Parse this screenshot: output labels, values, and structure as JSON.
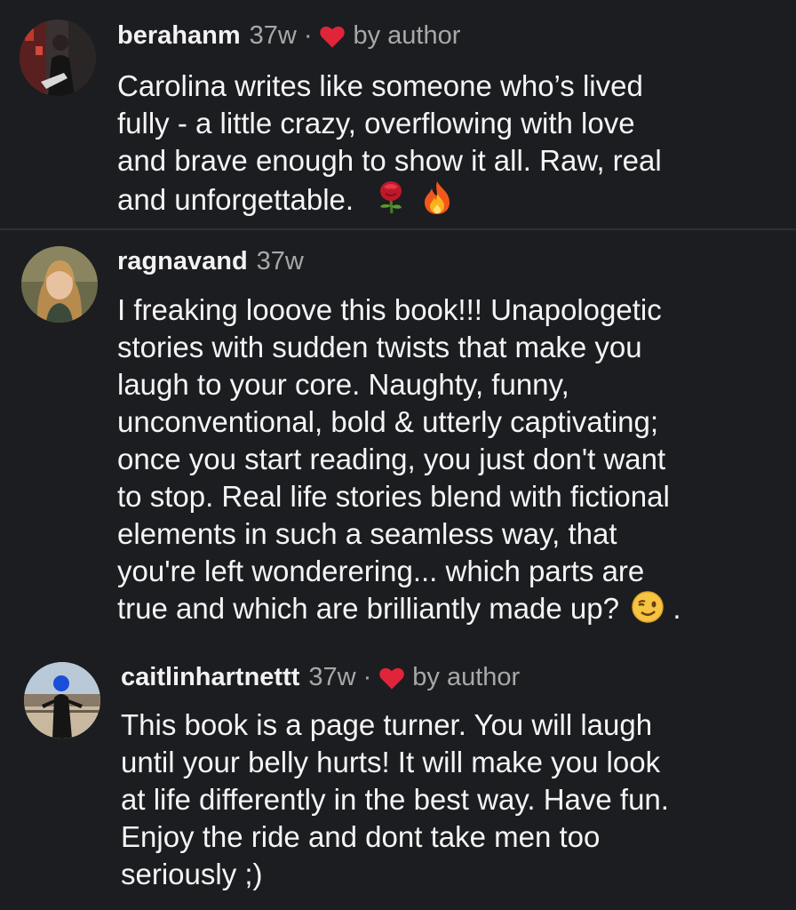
{
  "comments": [
    {
      "username": "berahanm",
      "time": "37w",
      "separator": "·",
      "liked_by_author": true,
      "by_author_label": "by author",
      "avatar_icon": "avatar-photo",
      "lines": [
        "Carolina writes like someone who’s lived",
        "fully - a little crazy, overflowing with love",
        "and brave enough to show it all. Raw, real",
        "and unforgettable."
      ],
      "trailing_emoji": [
        "rose-icon",
        "fire-icon"
      ]
    },
    {
      "username": "ragnavand",
      "time": "37w",
      "liked_by_author": false,
      "avatar_icon": "avatar-photo",
      "lines": [
        "I freaking looove this book!!! Unapologetic",
        "stories with sudden twists that make you",
        "laugh to your core. Naughty, funny,",
        "unconventional, bold & utterly captivating;",
        "once you start reading, you just don't want",
        "to stop. Real life stories blend  with fictional",
        "elements in such a seamless way, that",
        "you're left wonderering... which parts are",
        "true and which are brilliantly made up?"
      ],
      "trailing_emoji": [
        "winking-face-icon"
      ],
      "trailing_text": " ."
    },
    {
      "username": "caitlinhartnettt",
      "time": "37w",
      "separator": "·",
      "liked_by_author": true,
      "by_author_label": "by author",
      "avatar_icon": "avatar-photo",
      "lines": [
        "This book is a page turner. You will laugh",
        "until your belly hurts! It will make you look",
        "at life differently in the best way. Have fun.",
        "Enjoy the ride and dont take men too",
        "seriously ;)"
      ]
    }
  ],
  "colors": {
    "background": "#1c1d20",
    "text": "#f5f5f5",
    "muted": "#a8a8a8",
    "heart": "#e0243a"
  }
}
